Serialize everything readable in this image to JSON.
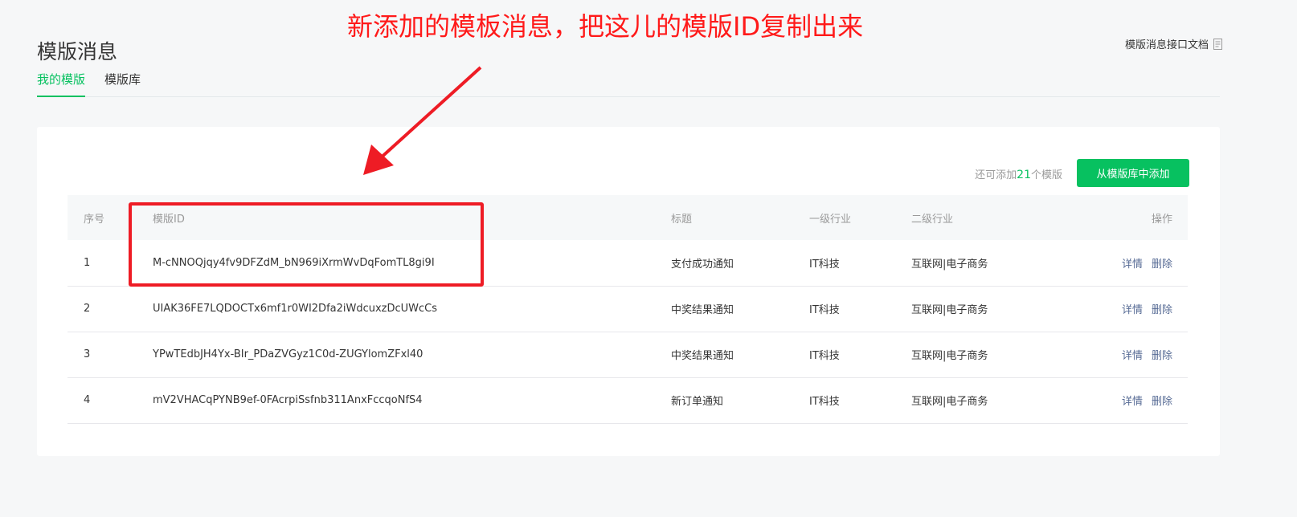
{
  "header": {
    "title": "模版消息",
    "doc_link": "模版消息接口文档",
    "doc_icon": "document-icon"
  },
  "tabs": [
    {
      "label": "我的模版",
      "active": true
    },
    {
      "label": "模版库",
      "active": false
    }
  ],
  "toolbar": {
    "quota_prefix": "还可添加",
    "quota_count": "21",
    "quota_suffix": "个模版",
    "add_button": "从模版库中添加"
  },
  "table": {
    "headers": [
      "序号",
      "模版ID",
      "标题",
      "一级行业",
      "二级行业",
      "操作"
    ],
    "rows": [
      {
        "idx": "1",
        "template_id": "M-cNNOQjqy4fv9DFZdM_bN969iXrmWvDqFomTL8gi9I",
        "title": "支付成功通知",
        "industry1": "IT科技",
        "industry2": "互联网|电子商务",
        "detail": "详情",
        "delete": "删除"
      },
      {
        "idx": "2",
        "template_id": "UIAK36FE7LQDOCTx6mf1r0WI2Dfa2iWdcuxzDcUWcCs",
        "title": "中奖结果通知",
        "industry1": "IT科技",
        "industry2": "互联网|电子商务",
        "detail": "详情",
        "delete": "删除"
      },
      {
        "idx": "3",
        "template_id": "YPwTEdbJH4Yx-BIr_PDaZVGyz1C0d-ZUGYlomZFxl40",
        "title": "中奖结果通知",
        "industry1": "IT科技",
        "industry2": "互联网|电子商务",
        "detail": "详情",
        "delete": "删除"
      },
      {
        "idx": "4",
        "template_id": "mV2VHACqPYNB9ef-0FAcrpiSsfnb311AnxFccqoNfS4",
        "title": "新订单通知",
        "industry1": "IT科技",
        "industry2": "互联网|电子商务",
        "detail": "详情",
        "delete": "删除"
      }
    ]
  },
  "annotation": {
    "text": "新添加的模板消息，把这儿的模版ID复制出来",
    "color": "#ff1a1a"
  },
  "colors": {
    "accent": "#07c160",
    "link": "#576b95",
    "annotation_red": "#ee1c25"
  }
}
